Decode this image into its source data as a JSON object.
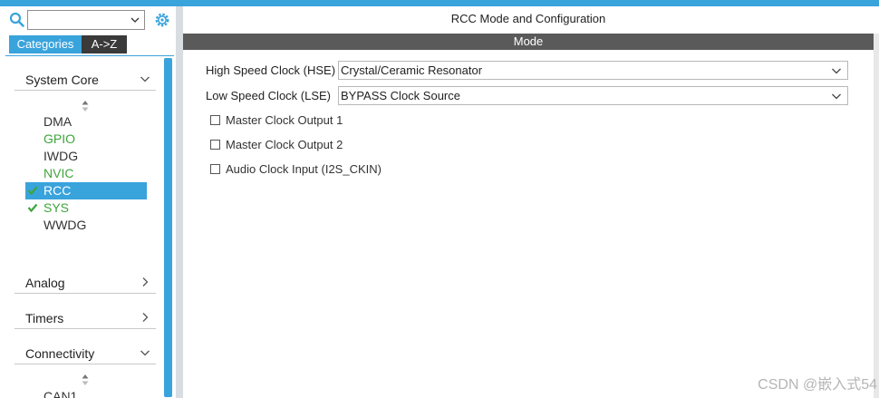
{
  "left_panel": {
    "search": {
      "value": ""
    },
    "tabs": {
      "categories": "Categories",
      "az": "A->Z"
    },
    "categories": [
      {
        "label": "System Core",
        "expanded": true
      },
      {
        "label": "Analog",
        "expanded": false
      },
      {
        "label": "Timers",
        "expanded": false
      },
      {
        "label": "Connectivity",
        "expanded": true
      }
    ],
    "system_core_items": [
      {
        "label": "DMA",
        "state": "normal"
      },
      {
        "label": "GPIO",
        "state": "green"
      },
      {
        "label": "IWDG",
        "state": "normal"
      },
      {
        "label": "NVIC",
        "state": "green"
      },
      {
        "label": "RCC",
        "state": "selected-checked"
      },
      {
        "label": "SYS",
        "state": "checked"
      },
      {
        "label": "WWDG",
        "state": "normal"
      }
    ],
    "connectivity_items": [
      {
        "label": "CAN1"
      }
    ]
  },
  "main": {
    "title": "RCC Mode and Configuration",
    "mode_header": "Mode",
    "hse": {
      "label": "High Speed Clock (HSE)",
      "value": "Crystal/Ceramic Resonator"
    },
    "lse": {
      "label": "Low Speed Clock (LSE)",
      "value": "BYPASS Clock Source"
    },
    "checkboxes": [
      {
        "label": "Master Clock Output 1",
        "checked": false
      },
      {
        "label": "Master Clock Output 2",
        "checked": false
      },
      {
        "label": "Audio Clock Input (I2S_CKIN)",
        "checked": false
      }
    ]
  },
  "watermark": "CSDN @嵌入式54",
  "colors": {
    "accent": "#39a3dc",
    "green": "#3fa53b",
    "mode_bar": "#5a5a5a",
    "tab_dark": "#3a3a3a"
  }
}
